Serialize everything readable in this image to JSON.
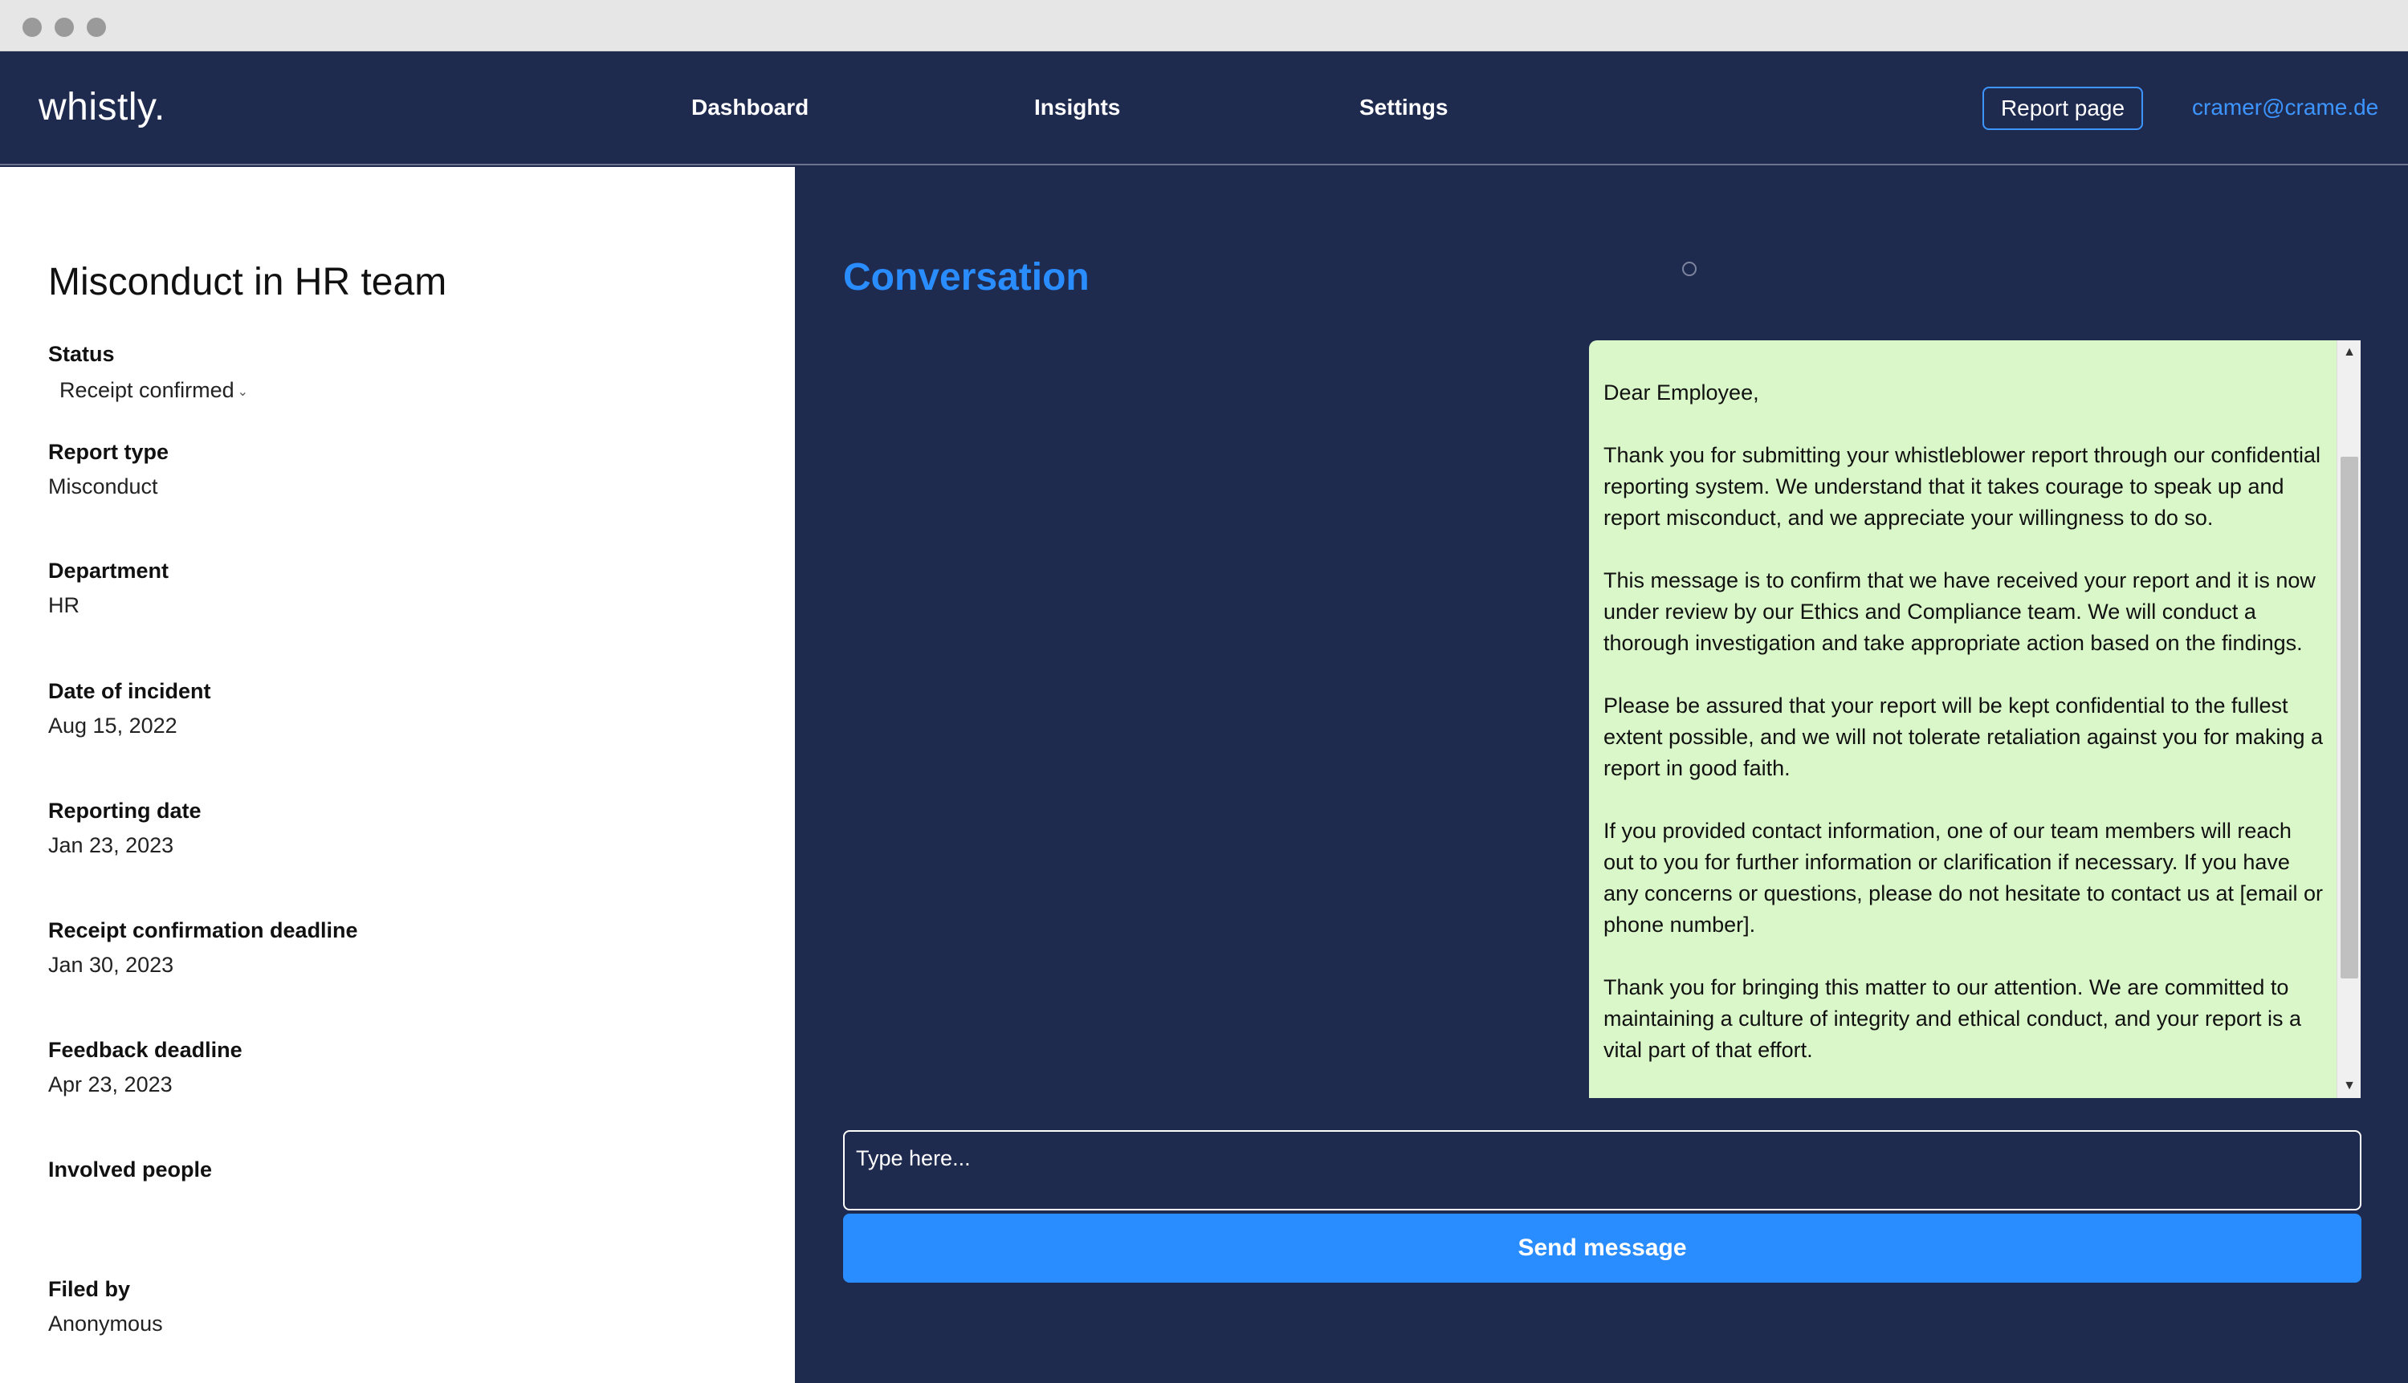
{
  "app": {
    "logo": "whistly."
  },
  "nav": {
    "links": [
      "Dashboard",
      "Insights",
      "Settings"
    ],
    "report_button": "Report page",
    "user_email": "cramer@crame.de"
  },
  "report": {
    "title": "Misconduct in HR team",
    "status": {
      "label": "Status",
      "value": "Receipt confirmed"
    },
    "fields": [
      {
        "label": "Report type",
        "value": "Misconduct"
      },
      {
        "label": "Department",
        "value": "HR"
      },
      {
        "label": "Date of incident",
        "value": "Aug 15, 2022"
      },
      {
        "label": "Reporting date",
        "value": "Jan 23, 2023"
      },
      {
        "label": "Receipt confirmation deadline",
        "value": "Jan 30, 2023"
      },
      {
        "label": "Feedback deadline",
        "value": "Apr 23, 2023"
      },
      {
        "label": "Involved people",
        "value": ""
      },
      {
        "label": "Filed by",
        "value": "Anonymous"
      }
    ]
  },
  "conversation": {
    "title": "Conversation",
    "message_paragraphs": [
      "Dear Employee,",
      "Thank you for submitting your whistleblower report through our confidential reporting system. We understand that it takes courage to speak up and report misconduct, and we appreciate your willingness to do so.",
      "This message is to confirm that we have received your report and it is now under review by our Ethics and Compliance team. We will conduct a thorough investigation and take appropriate action based on the findings.",
      "Please be assured that your report will be kept confidential to the fullest extent possible, and we will not tolerate retaliation against you for making a report in good faith.",
      "If you provided contact information, one of our team members will reach out to you for further information or clarification if necessary. If you have any concerns or questions, please do not hesitate to contact us at [email or phone number].",
      "Thank you for bringing this matter to our attention. We are committed to maintaining a culture of integrity and ethical conduct, and your report is a vital part of that effort."
    ],
    "input_placeholder": "Type here...",
    "send_label": "Send message"
  },
  "icons": {
    "status_chevron": "chevron-down-icon",
    "scroll_up": "arrow-up-icon",
    "scroll_down": "arrow-down-icon",
    "loading": "loading-circle-icon"
  },
  "colors": {
    "navy": "#1f2a4f",
    "accent_blue": "#2a8dff",
    "message_bg": "#d9f7c8"
  }
}
